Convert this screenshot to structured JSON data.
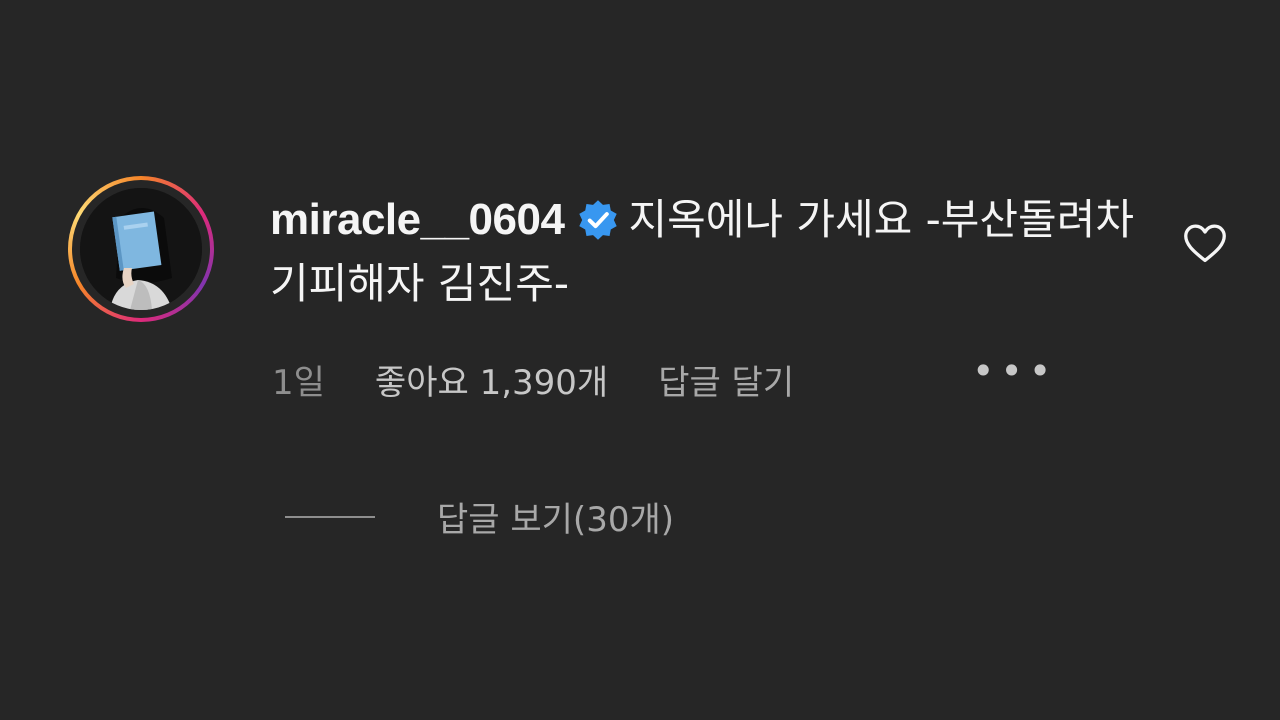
{
  "comment": {
    "username": "miracle__0604",
    "verified": true,
    "verified_icon": "verified-badge-icon",
    "text": "지옥에나 가세요 -부산돌려차기피해자 김진주-",
    "time": "1일",
    "likes": "좋아요 1,390개",
    "reply_action": "답글 달기",
    "more_icon": "more-options-icon",
    "like_icon": "heart-icon",
    "view_replies": "답글 보기(30개)"
  },
  "colors": {
    "background": "#262626",
    "verified_blue": "#3897f0",
    "primary_text": "#f5f5f5",
    "secondary_text": "#a8a8a8"
  }
}
